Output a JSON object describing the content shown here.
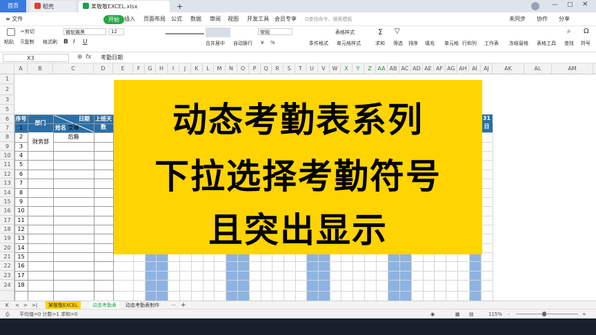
{
  "window": {
    "tabs": [
      {
        "label": "首页"
      },
      {
        "label": "稻壳"
      },
      {
        "label": "某敬敬EXCEL.xlsx"
      }
    ],
    "new_tab": "+"
  },
  "menu": {
    "file": "≡ 文件",
    "items": [
      "开始",
      "插入",
      "页面布局",
      "公式",
      "数据",
      "审阅",
      "视图",
      "开发工具",
      "会员专享"
    ],
    "search_placeholder": "Q查找命令、搜索模板",
    "right": [
      "未同步",
      "协作",
      "分享"
    ]
  },
  "ribbon": {
    "clipboard": {
      "paste": "粘贴",
      "cut": "剪切",
      "copy": "复制",
      "format_painter": "格式刷"
    },
    "font": {
      "name": "微软雅黑",
      "size": "12",
      "bold": "B",
      "italic": "I",
      "underline": "U"
    },
    "align": {
      "merge": "合并居中",
      "wrap": "自动换行"
    },
    "number": {
      "format": "常规",
      "currency": "¥",
      "percent": "%"
    },
    "styles": [
      "表格样式",
      "条件格式",
      "单元格样式"
    ],
    "tools": [
      "求和",
      "筛选",
      "排序",
      "填充",
      "单元格",
      "行和列",
      "工作表",
      "冻结窗格",
      "表格工具",
      "查找",
      "符号"
    ]
  },
  "formula_bar": {
    "cell_ref": "X3",
    "fx": "fx",
    "content": "考勤日期"
  },
  "grid": {
    "columns": [
      "A",
      "B",
      "C",
      "D",
      "E",
      "F",
      "G",
      "H",
      "I",
      "J",
      "K",
      "L",
      "M",
      "N",
      "O",
      "P",
      "Q",
      "R",
      "S",
      "T",
      "U",
      "V",
      "W",
      "X",
      "Y",
      "Z",
      "AA",
      "AB",
      "AC",
      "AD",
      "AE",
      "AF",
      "AG",
      "AH",
      "AI",
      "AJ",
      "AK",
      "AL",
      "AM"
    ],
    "rows": [
      "1",
      "2",
      "3",
      "5",
      "6",
      "7",
      "8",
      "9",
      "10",
      "11",
      "12",
      "13",
      "14",
      "15",
      "16",
      "17",
      "18",
      "19",
      "20",
      "21",
      "22",
      "23",
      "24"
    ],
    "header": {
      "seq": "序号",
      "dept": "部门",
      "date": "日期",
      "name": "姓名",
      "workdays": "上班天数",
      "day31": "31日"
    },
    "seq_numbers": [
      "1",
      "2",
      "3",
      "4",
      "5",
      "6",
      "7",
      "8",
      "9",
      "10",
      "11",
      "12",
      "13",
      "14",
      "15",
      "16",
      "17",
      "18"
    ],
    "department": "财务部",
    "names": [
      "艾琳",
      "后裔"
    ]
  },
  "banner": {
    "lines": [
      "动态考勤表系列",
      "下拉选择考勤符号",
      "且突出显示"
    ],
    "color": "#ffd400"
  },
  "sheets": {
    "nav": [
      "K",
      "<",
      ">",
      ">|"
    ],
    "tabs": [
      "某敬敬EXCEL",
      "动态考勤表",
      "动态考勤表制作"
    ],
    "more": "···",
    "add": "+"
  },
  "status": {
    "stats": "平均值=0  计数=1  求和=0",
    "zoom": "115%",
    "zoom_minus": "-",
    "zoom_plus": "+"
  },
  "colors": {
    "accent": "#28a745",
    "header_blue": "#2a6fa8",
    "weekend_blue": "#8db3e2"
  }
}
